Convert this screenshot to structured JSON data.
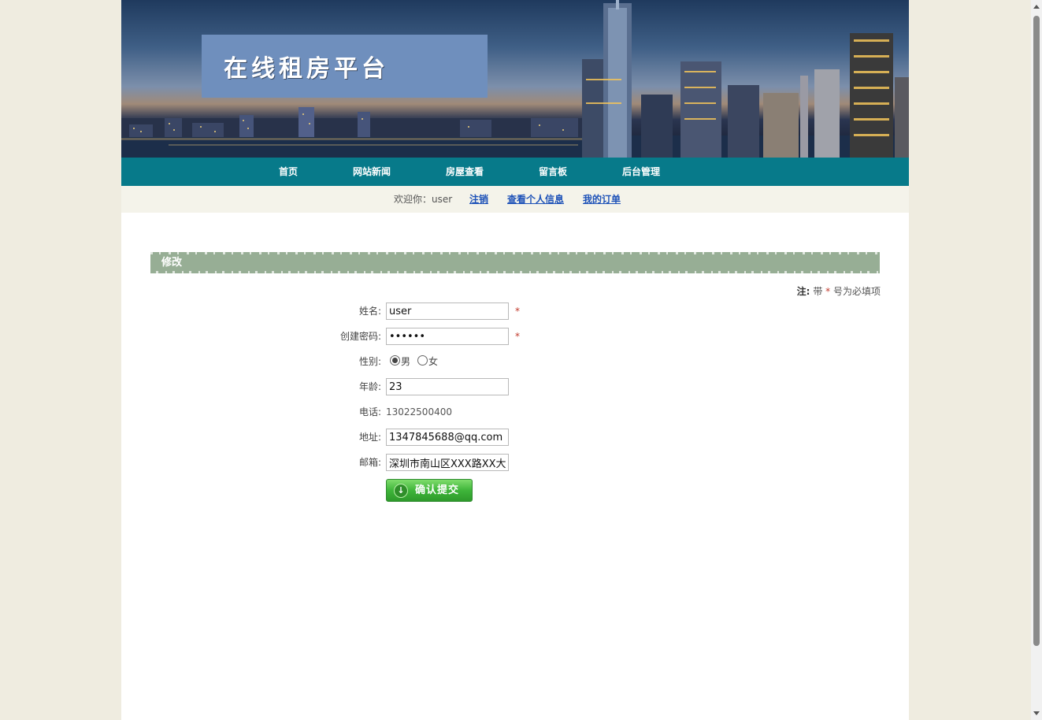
{
  "banner": {
    "title": "在线租房平台"
  },
  "nav": {
    "items": [
      {
        "label": "首页"
      },
      {
        "label": "网站新闻"
      },
      {
        "label": "房屋查看"
      },
      {
        "label": "留言板"
      },
      {
        "label": "后台管理"
      }
    ]
  },
  "userbar": {
    "welcome": "欢迎你：",
    "username": "user",
    "logout": "注销",
    "profile": "查看个人信息",
    "orders": "我的订单"
  },
  "section": {
    "title": "修改"
  },
  "note": {
    "label": "注:",
    "prefix": "带",
    "star": "*",
    "suffix": "号为必填项"
  },
  "form": {
    "name_label": "姓名:",
    "name_value": "user",
    "password_label": "创建密码:",
    "password_value": "123456",
    "gender_label": "性别:",
    "gender_options": [
      "男",
      "女"
    ],
    "gender_selected": "男",
    "age_label": "年龄:",
    "age_value": "23",
    "phone_label": "电话:",
    "phone_value": "13022500400",
    "address_label": "地址:",
    "address_value": "1347845688@qq.com",
    "email_label": "邮箱:",
    "email_value": "深圳市南山区XXX路XX大",
    "required_mark": "*",
    "submit_label": "确认提交",
    "submit_icon": "arrow-down-circle-icon"
  },
  "colors": {
    "nav_bg": "#077a8a",
    "section_header_bg": "#97ae95",
    "link": "#1e52b8",
    "required": "#c0392b",
    "button_green": "#3fb53a"
  }
}
